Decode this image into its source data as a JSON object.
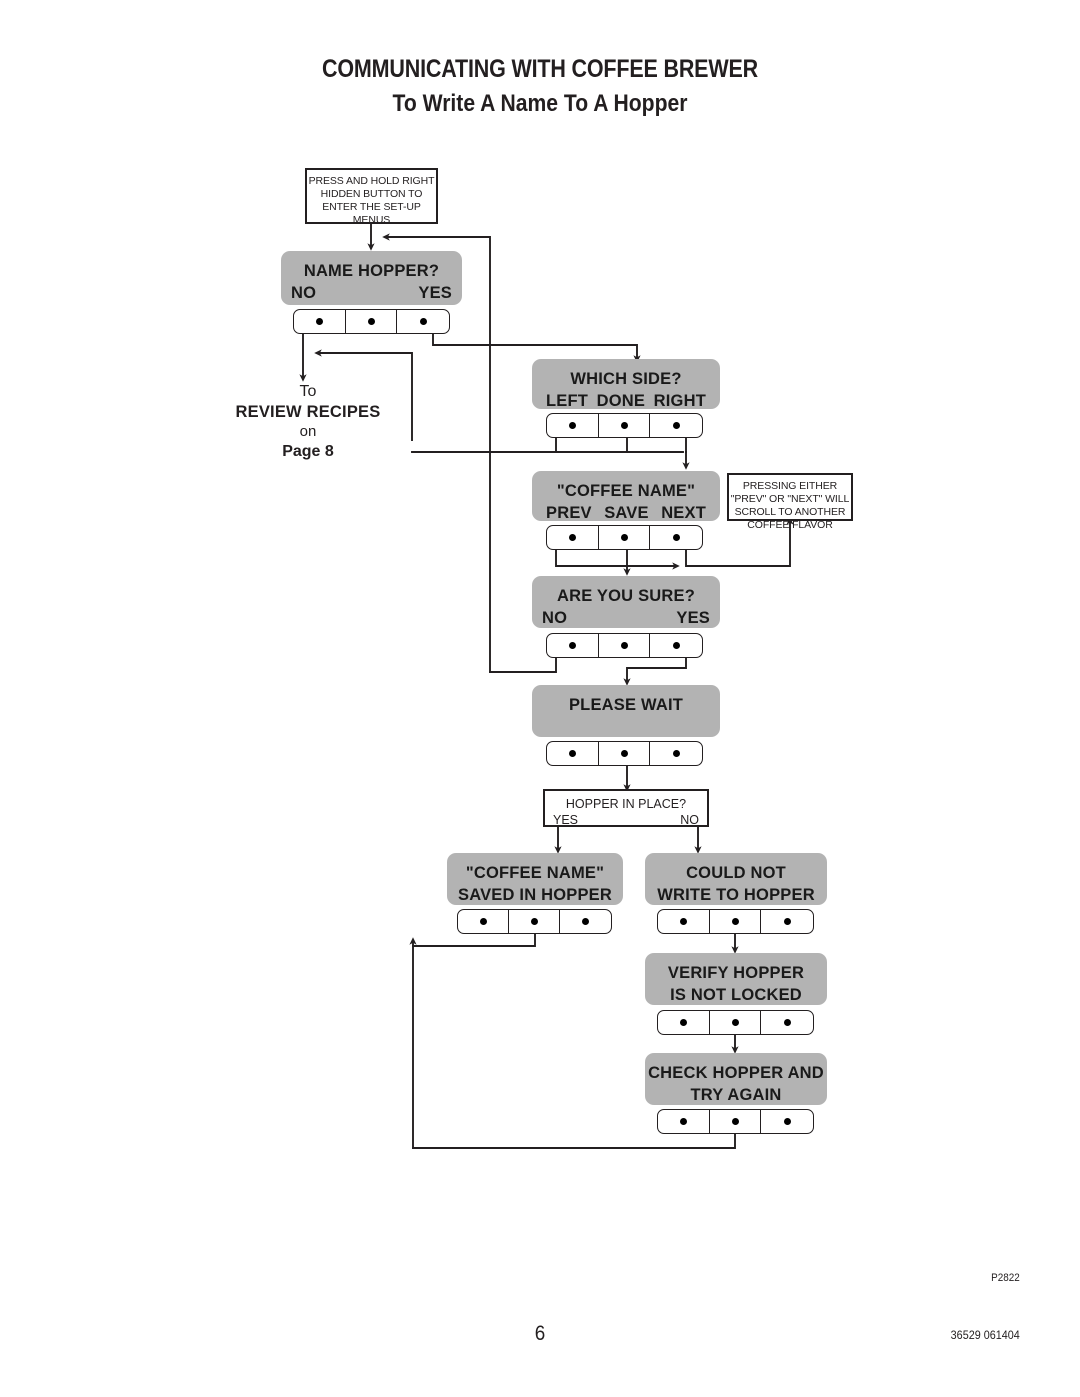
{
  "page": {
    "title": "COMMUNICATING WITH COFFEE BREWER",
    "subtitle": "To Write A Name To A Hopper",
    "page_number": "6",
    "figure_code": "P2822",
    "part_number": "36529 061404"
  },
  "notes": {
    "entry": "PRESS AND HOLD RIGHT HIDDEN BUTTON TO ENTER THE SET-UP MENUS",
    "scroll": "PRESSING EITHER \"PREV\" OR \"NEXT\" WILL SCROLL TO ANOTHER COFFEE FLAVOR"
  },
  "offpage": {
    "line1": "To",
    "line2": "REVIEW RECIPES",
    "line3": "on",
    "line4": "Page 8"
  },
  "screens": {
    "name_hopper": {
      "line1": "NAME HOPPER?",
      "left": "NO",
      "right": "YES"
    },
    "which_side": {
      "line1": "WHICH SIDE?",
      "left": "LEFT",
      "center": "DONE",
      "right": "RIGHT"
    },
    "coffee_name": {
      "line1": "\"COFFEE NAME\"",
      "left": "PREV",
      "center": "SAVE",
      "right": "NEXT"
    },
    "are_you_sure": {
      "line1": "ARE YOU SURE?",
      "left": "NO",
      "right": "YES"
    },
    "please_wait": {
      "line1": "PLEASE WAIT"
    },
    "saved_in_hopper": {
      "line1": "\"COFFEE NAME\"",
      "line2": "SAVED IN HOPPER"
    },
    "could_not_write": {
      "line1": "COULD NOT",
      "line2": "WRITE TO HOPPER"
    },
    "verify_hopper": {
      "line1": "VERIFY HOPPER",
      "line2": "IS NOT LOCKED"
    },
    "check_hopper": {
      "line1": "CHECK HOPPER AND",
      "line2": "TRY AGAIN"
    }
  },
  "decision": {
    "hopper_in_place": {
      "question": "HOPPER IN PLACE?",
      "yes": "YES",
      "no": "NO"
    }
  },
  "colors": {
    "lcd_background": "#b3b3b3",
    "line": "#231f20",
    "paper": "#ffffff"
  },
  "chart_data": {
    "type": "diagram",
    "title": "To Write A Name To A Hopper"
  }
}
